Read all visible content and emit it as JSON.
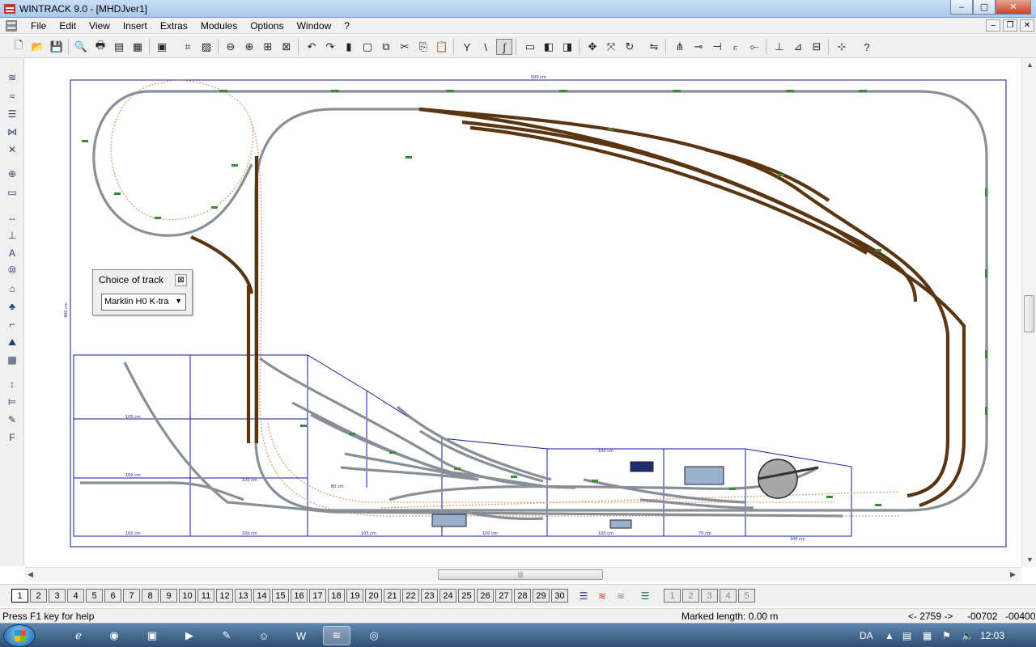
{
  "window": {
    "title": "WINTRACK 9.0 - [MHDJver1]",
    "minimize": "–",
    "maximize": "▢",
    "close": "✕"
  },
  "menu": {
    "items": [
      "File",
      "Edit",
      "View",
      "Insert",
      "Extras",
      "Modules",
      "Options",
      "Window",
      "?"
    ],
    "mdi_minimize": "–",
    "mdi_restore": "❐",
    "mdi_close": "✕"
  },
  "choice_of_track": {
    "title": "Choice of track",
    "close": "⊠",
    "selected": "Marklin H0 K-tra",
    "arrow": "▼"
  },
  "canvas": {
    "dimensions": {
      "width_label": "500 cm",
      "height_label": "400 cm"
    },
    "module_labels": [
      "100 cm",
      "100 cm",
      "100 cm",
      "100 cm",
      "100 cm",
      "100 cm",
      "100 cm",
      "105 cm",
      "100 cm",
      "100 cm",
      "70 cm",
      "80 cm"
    ],
    "colors": {
      "border": "#1a1a8a",
      "track_gray": "#9aa0a6",
      "track_brown": "#5a3511",
      "dotted_route": "#d8a070",
      "label_green": "#3a8a3a",
      "module_line": "#1a1a9a"
    }
  },
  "hscroll": {
    "grip": "|||"
  },
  "layers": [
    "1",
    "2",
    "3",
    "4",
    "5",
    "6",
    "7",
    "8",
    "9",
    "10",
    "11",
    "12",
    "13",
    "14",
    "15",
    "16",
    "17",
    "18",
    "19",
    "20",
    "21",
    "22",
    "23",
    "24",
    "25",
    "26",
    "27",
    "28",
    "29",
    "30"
  ],
  "layer_tools": [
    "1",
    "2",
    "3",
    "4",
    "5"
  ],
  "status": {
    "help": "Press F1 key for help",
    "marked_length": "Marked length: 0.00 m",
    "position": "<- 2759 ->",
    "x": "-00702",
    "y": "-00400"
  },
  "taskbar": {
    "lang": "DA",
    "clock": "12:03"
  }
}
